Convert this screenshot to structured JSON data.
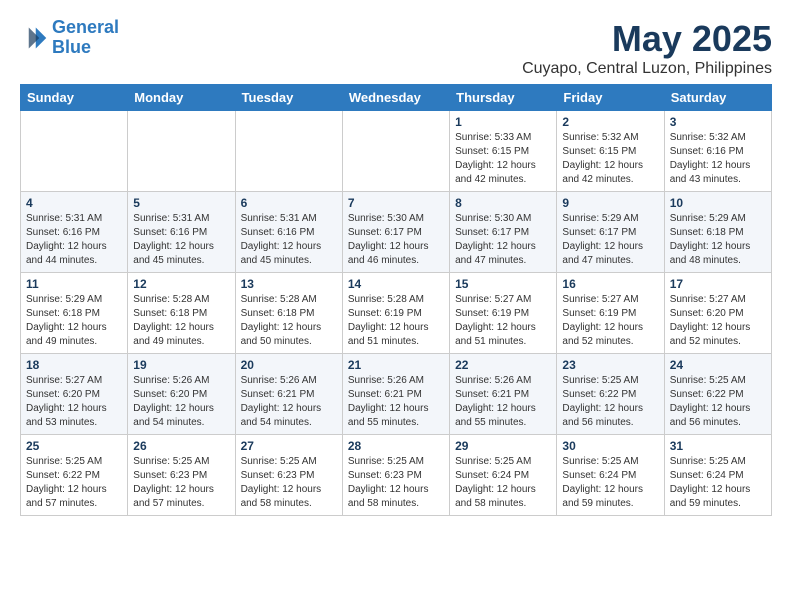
{
  "header": {
    "logo_line1": "General",
    "logo_line2": "Blue",
    "month": "May 2025",
    "location": "Cuyapo, Central Luzon, Philippines"
  },
  "weekdays": [
    "Sunday",
    "Monday",
    "Tuesday",
    "Wednesday",
    "Thursday",
    "Friday",
    "Saturday"
  ],
  "weeks": [
    [
      {
        "day": "",
        "info": ""
      },
      {
        "day": "",
        "info": ""
      },
      {
        "day": "",
        "info": ""
      },
      {
        "day": "",
        "info": ""
      },
      {
        "day": "1",
        "info": "Sunrise: 5:33 AM\nSunset: 6:15 PM\nDaylight: 12 hours\nand 42 minutes."
      },
      {
        "day": "2",
        "info": "Sunrise: 5:32 AM\nSunset: 6:15 PM\nDaylight: 12 hours\nand 42 minutes."
      },
      {
        "day": "3",
        "info": "Sunrise: 5:32 AM\nSunset: 6:16 PM\nDaylight: 12 hours\nand 43 minutes."
      }
    ],
    [
      {
        "day": "4",
        "info": "Sunrise: 5:31 AM\nSunset: 6:16 PM\nDaylight: 12 hours\nand 44 minutes."
      },
      {
        "day": "5",
        "info": "Sunrise: 5:31 AM\nSunset: 6:16 PM\nDaylight: 12 hours\nand 45 minutes."
      },
      {
        "day": "6",
        "info": "Sunrise: 5:31 AM\nSunset: 6:16 PM\nDaylight: 12 hours\nand 45 minutes."
      },
      {
        "day": "7",
        "info": "Sunrise: 5:30 AM\nSunset: 6:17 PM\nDaylight: 12 hours\nand 46 minutes."
      },
      {
        "day": "8",
        "info": "Sunrise: 5:30 AM\nSunset: 6:17 PM\nDaylight: 12 hours\nand 47 minutes."
      },
      {
        "day": "9",
        "info": "Sunrise: 5:29 AM\nSunset: 6:17 PM\nDaylight: 12 hours\nand 47 minutes."
      },
      {
        "day": "10",
        "info": "Sunrise: 5:29 AM\nSunset: 6:18 PM\nDaylight: 12 hours\nand 48 minutes."
      }
    ],
    [
      {
        "day": "11",
        "info": "Sunrise: 5:29 AM\nSunset: 6:18 PM\nDaylight: 12 hours\nand 49 minutes."
      },
      {
        "day": "12",
        "info": "Sunrise: 5:28 AM\nSunset: 6:18 PM\nDaylight: 12 hours\nand 49 minutes."
      },
      {
        "day": "13",
        "info": "Sunrise: 5:28 AM\nSunset: 6:18 PM\nDaylight: 12 hours\nand 50 minutes."
      },
      {
        "day": "14",
        "info": "Sunrise: 5:28 AM\nSunset: 6:19 PM\nDaylight: 12 hours\nand 51 minutes."
      },
      {
        "day": "15",
        "info": "Sunrise: 5:27 AM\nSunset: 6:19 PM\nDaylight: 12 hours\nand 51 minutes."
      },
      {
        "day": "16",
        "info": "Sunrise: 5:27 AM\nSunset: 6:19 PM\nDaylight: 12 hours\nand 52 minutes."
      },
      {
        "day": "17",
        "info": "Sunrise: 5:27 AM\nSunset: 6:20 PM\nDaylight: 12 hours\nand 52 minutes."
      }
    ],
    [
      {
        "day": "18",
        "info": "Sunrise: 5:27 AM\nSunset: 6:20 PM\nDaylight: 12 hours\nand 53 minutes."
      },
      {
        "day": "19",
        "info": "Sunrise: 5:26 AM\nSunset: 6:20 PM\nDaylight: 12 hours\nand 54 minutes."
      },
      {
        "day": "20",
        "info": "Sunrise: 5:26 AM\nSunset: 6:21 PM\nDaylight: 12 hours\nand 54 minutes."
      },
      {
        "day": "21",
        "info": "Sunrise: 5:26 AM\nSunset: 6:21 PM\nDaylight: 12 hours\nand 55 minutes."
      },
      {
        "day": "22",
        "info": "Sunrise: 5:26 AM\nSunset: 6:21 PM\nDaylight: 12 hours\nand 55 minutes."
      },
      {
        "day": "23",
        "info": "Sunrise: 5:25 AM\nSunset: 6:22 PM\nDaylight: 12 hours\nand 56 minutes."
      },
      {
        "day": "24",
        "info": "Sunrise: 5:25 AM\nSunset: 6:22 PM\nDaylight: 12 hours\nand 56 minutes."
      }
    ],
    [
      {
        "day": "25",
        "info": "Sunrise: 5:25 AM\nSunset: 6:22 PM\nDaylight: 12 hours\nand 57 minutes."
      },
      {
        "day": "26",
        "info": "Sunrise: 5:25 AM\nSunset: 6:23 PM\nDaylight: 12 hours\nand 57 minutes."
      },
      {
        "day": "27",
        "info": "Sunrise: 5:25 AM\nSunset: 6:23 PM\nDaylight: 12 hours\nand 58 minutes."
      },
      {
        "day": "28",
        "info": "Sunrise: 5:25 AM\nSunset: 6:23 PM\nDaylight: 12 hours\nand 58 minutes."
      },
      {
        "day": "29",
        "info": "Sunrise: 5:25 AM\nSunset: 6:24 PM\nDaylight: 12 hours\nand 58 minutes."
      },
      {
        "day": "30",
        "info": "Sunrise: 5:25 AM\nSunset: 6:24 PM\nDaylight: 12 hours\nand 59 minutes."
      },
      {
        "day": "31",
        "info": "Sunrise: 5:25 AM\nSunset: 6:24 PM\nDaylight: 12 hours\nand 59 minutes."
      }
    ]
  ]
}
